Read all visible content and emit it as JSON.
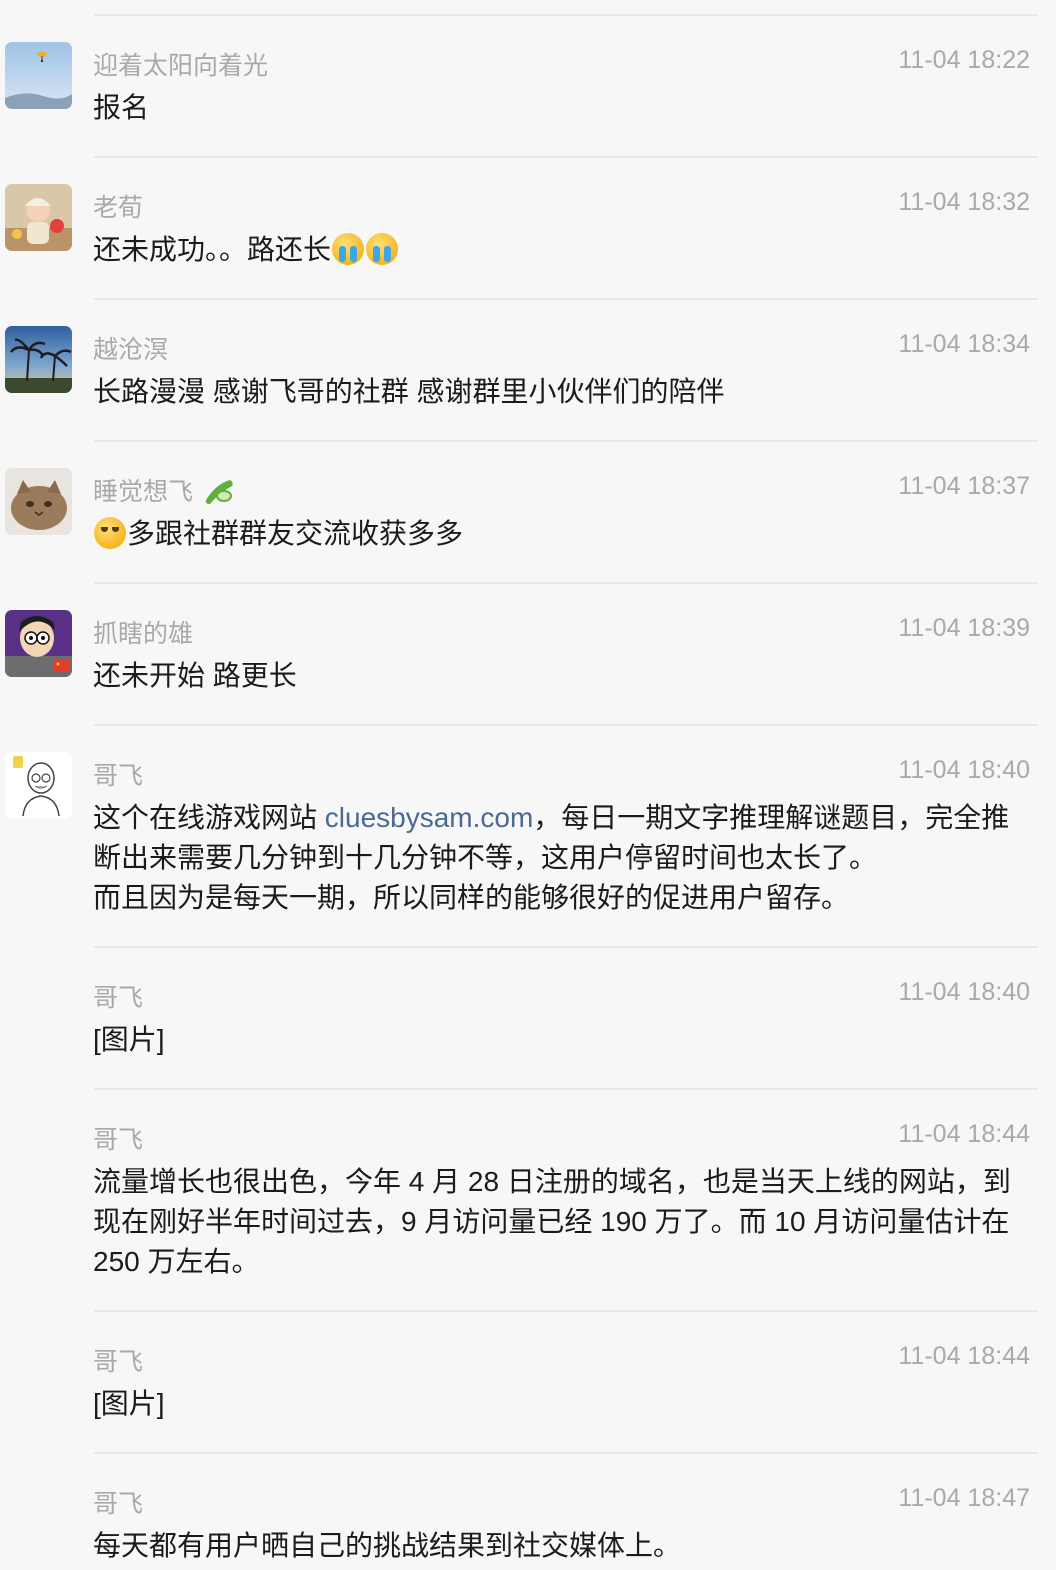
{
  "messages": [
    {
      "name": "迎着太阳向着光",
      "time": "11-04 18:22",
      "text": "报名",
      "avatar": "parachute-sky-avatar"
    },
    {
      "name": "老荀",
      "time": "11-04 18:32",
      "text_before": "还未成功。。路还长",
      "emojis": [
        "crying-face-emoji",
        "crying-face-emoji"
      ],
      "avatar": "child-photo-avatar"
    },
    {
      "name": "越沧溟",
      "time": "11-04 18:34",
      "text": "长路漫漫 感谢飞哥的社群 感谢群里小伙伴们的陪伴",
      "avatar": "palm-tree-avatar"
    },
    {
      "name": "睡觉想飞",
      "name_emoji": "cucumber-icon",
      "time": "11-04 18:37",
      "text_after": "多跟社群群友交流收获多多",
      "emojis": [
        "thinking-face-emoji"
      ],
      "avatar": "cat-avatar"
    },
    {
      "name": "抓瞎的雄",
      "time": "11-04 18:39",
      "text": "还未开始 路更长",
      "avatar": "cartoon-character-avatar"
    },
    {
      "name": "哥飞",
      "time": "11-04 18:40",
      "text_before": "这个在线游戏网站 ",
      "link": "cluesbysam.com",
      "text_after": "，每日一期文字推理解谜题目，完全推断出来需要几分钟到十几分钟不等，这用户停留时间也太长了。",
      "text_line2": "而且因为是每天一期，所以同样的能够很好的促进用户留存。",
      "avatar": "bald-man-sketch-avatar"
    },
    {
      "name": "哥飞",
      "time": "11-04 18:40",
      "text": "[图片]"
    },
    {
      "name": "哥飞",
      "time": "11-04 18:44",
      "text": "流量增长也很出色，今年 4 月 28 日注册的域名，也是当天上线的网站，到现在刚好半年时间过去，9 月访问量已经 190 万了。而 10 月访问量估计在 250 万左右。"
    },
    {
      "name": "哥飞",
      "time": "11-04 18:44",
      "text": "[图片]"
    },
    {
      "name": "哥飞",
      "time": "11-04 18:47",
      "text": "每天都有用户晒自己的挑战结果到社交媒体上。"
    }
  ]
}
